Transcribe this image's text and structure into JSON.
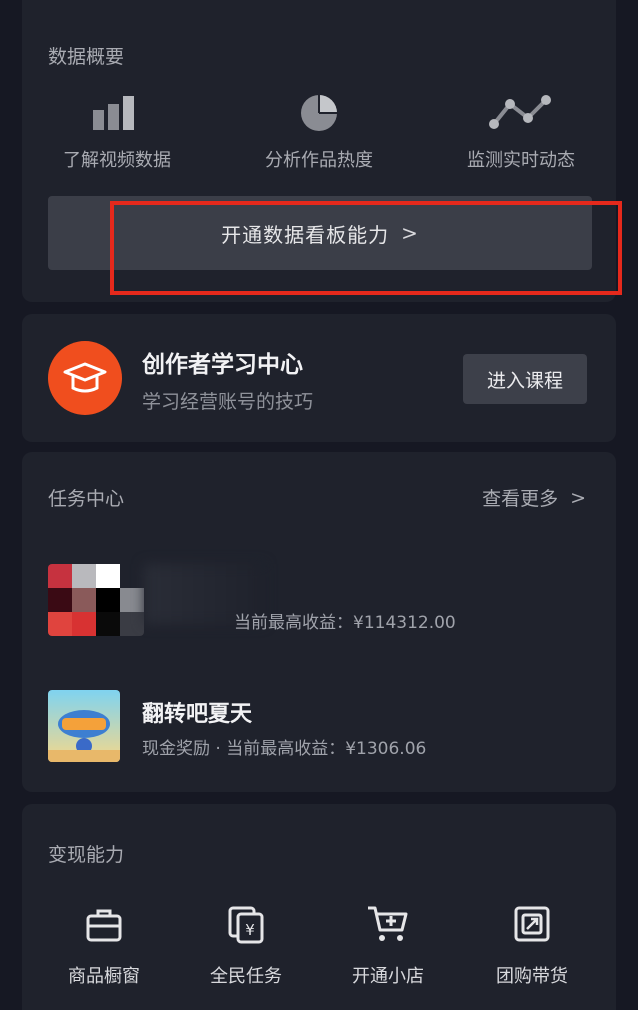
{
  "data_overview": {
    "title": "数据概要",
    "stats": [
      {
        "icon": "bar-chart-icon",
        "label": "了解视频数据"
      },
      {
        "icon": "pie-chart-icon",
        "label": "分析作品热度"
      },
      {
        "icon": "line-chart-icon",
        "label": "监测实时动态"
      }
    ],
    "open_button": "开通数据看板能力",
    "chevron": ">"
  },
  "learning": {
    "icon": "graduation-cap-icon",
    "title": "创作者学习中心",
    "subtitle": "学习经营账号的技巧",
    "button": "进入课程"
  },
  "tasks": {
    "title": "任务中心",
    "more": "查看更多",
    "chevron": ">",
    "items": [
      {
        "name": "",
        "reward": "当前最高收益：¥114312.00"
      },
      {
        "name": "翻转吧夏天",
        "reward": "现金奖励 · 当前最高收益：¥1306.06"
      }
    ]
  },
  "monetization": {
    "title": "变现能力",
    "items": [
      {
        "icon": "shop-window-icon",
        "label": "商品橱窗"
      },
      {
        "icon": "task-yen-icon",
        "label": "全民任务"
      },
      {
        "icon": "cart-icon",
        "label": "开通小店"
      },
      {
        "icon": "group-buy-icon",
        "label": "团购带货"
      }
    ]
  },
  "colors": {
    "background": "#161823",
    "card": "#1f222c",
    "accent_orange": "#f04e1e",
    "highlight_red": "#e5291c"
  }
}
